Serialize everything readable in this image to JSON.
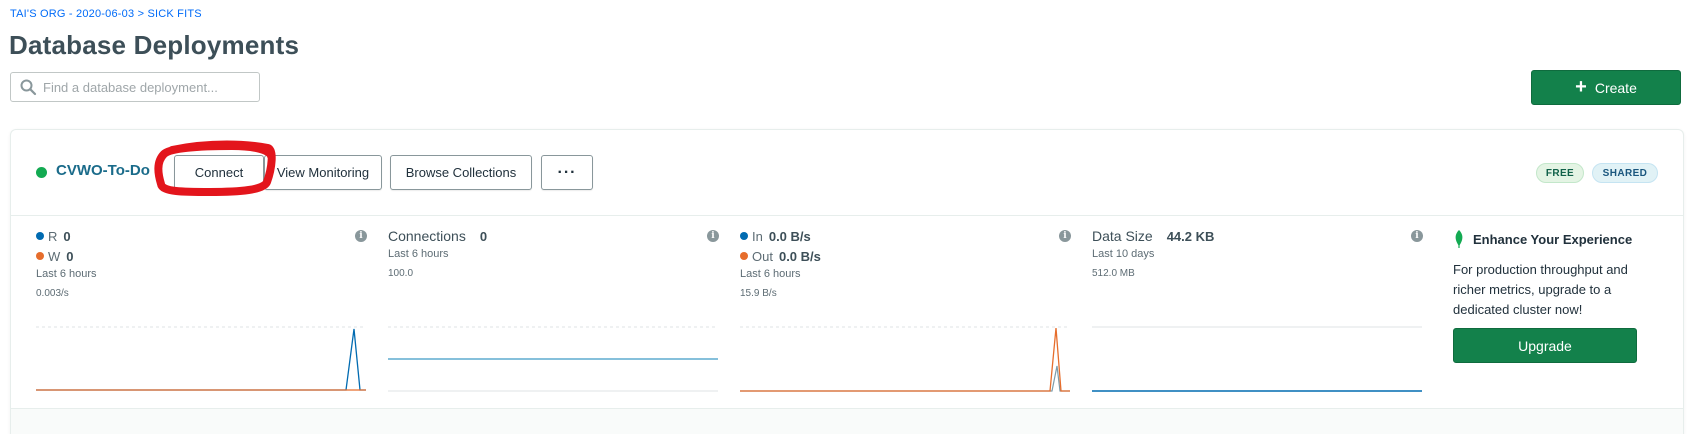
{
  "breadcrumb": {
    "org": "TAI'S ORG - 2020-06-03",
    "separator": ">",
    "project": "SICK FITS"
  },
  "page_title": "Database Deployments",
  "search": {
    "placeholder": "Find a database deployment...",
    "value": ""
  },
  "create_button": {
    "label": "Create",
    "icon": "plus-icon"
  },
  "cluster": {
    "name": "CVWO-To-Do",
    "status_color": "#13aa52",
    "buttons": {
      "connect": "Connect",
      "monitoring": "View Monitoring",
      "browse": "Browse Collections",
      "more": "···"
    },
    "badges": {
      "tier": "FREE",
      "type": "SHARED"
    }
  },
  "metrics": {
    "ops": {
      "r_label": "R",
      "r_value": "0",
      "w_label": "W",
      "w_value": "0",
      "period": "Last 6 hours",
      "scale": "0.003/s",
      "r_color": "#016bb1",
      "w_color": "#e66d2c"
    },
    "connections": {
      "label": "Connections",
      "value": "0",
      "period": "Last 6 hours",
      "scale": "100.0",
      "color": "#3f9bc5"
    },
    "network": {
      "in_label": "In",
      "in_value": "0.0 B/s",
      "out_label": "Out",
      "out_value": "0.0 B/s",
      "period": "Last 6 hours",
      "scale": "15.9 B/s",
      "in_color": "#016bb1",
      "out_color": "#e66d2c"
    },
    "data_size": {
      "label": "Data Size",
      "value": "44.2 KB",
      "period": "Last 10 days",
      "scale": "512.0 MB",
      "color": "#016bb1"
    }
  },
  "upsell": {
    "title": "Enhance Your Experience",
    "icon": "leaf-icon",
    "text": "For production throughput and richer metrics, upgrade to a dedicated cluster now!",
    "button": "Upgrade"
  },
  "colors": {
    "accent": "#13814b",
    "link": "#016bf8",
    "annotation": "#e3151c"
  }
}
